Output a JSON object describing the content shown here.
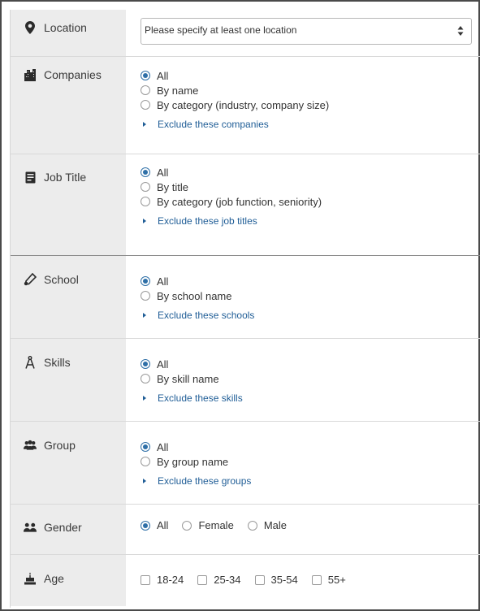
{
  "location": {
    "label": "Location",
    "icon": "map-pin-icon",
    "select_value": "Please specify at least one location"
  },
  "companies": {
    "label": "Companies",
    "icon": "buildings-icon",
    "options": [
      "All",
      "By name",
      "By category (industry, company size)"
    ],
    "selected": 0,
    "exclude": "Exclude these companies"
  },
  "job_title": {
    "label": "Job Title",
    "icon": "id-card-icon",
    "options": [
      "All",
      "By title",
      "By category (job function, seniority)"
    ],
    "selected": 0,
    "exclude": "Exclude these job titles"
  },
  "school": {
    "label": "School",
    "icon": "diploma-icon",
    "options": [
      "All",
      "By school name"
    ],
    "selected": 0,
    "exclude": "Exclude these schools"
  },
  "skills": {
    "label": "Skills",
    "icon": "compass-icon",
    "options": [
      "All",
      "By skill name"
    ],
    "selected": 0,
    "exclude": "Exclude these skills"
  },
  "group": {
    "label": "Group",
    "icon": "group-icon",
    "options": [
      "All",
      "By group name"
    ],
    "selected": 0,
    "exclude": "Exclude these groups"
  },
  "gender": {
    "label": "Gender",
    "icon": "people-icon",
    "options": [
      "All",
      "Female",
      "Male"
    ],
    "selected": 0
  },
  "age": {
    "label": "Age",
    "icon": "cake-icon",
    "options": [
      "18-24",
      "25-34",
      "35-54",
      "55+"
    ]
  },
  "colors": {
    "accent": "#2e6fa7",
    "link": "#1f5d96",
    "label_bg": "#ececec"
  }
}
